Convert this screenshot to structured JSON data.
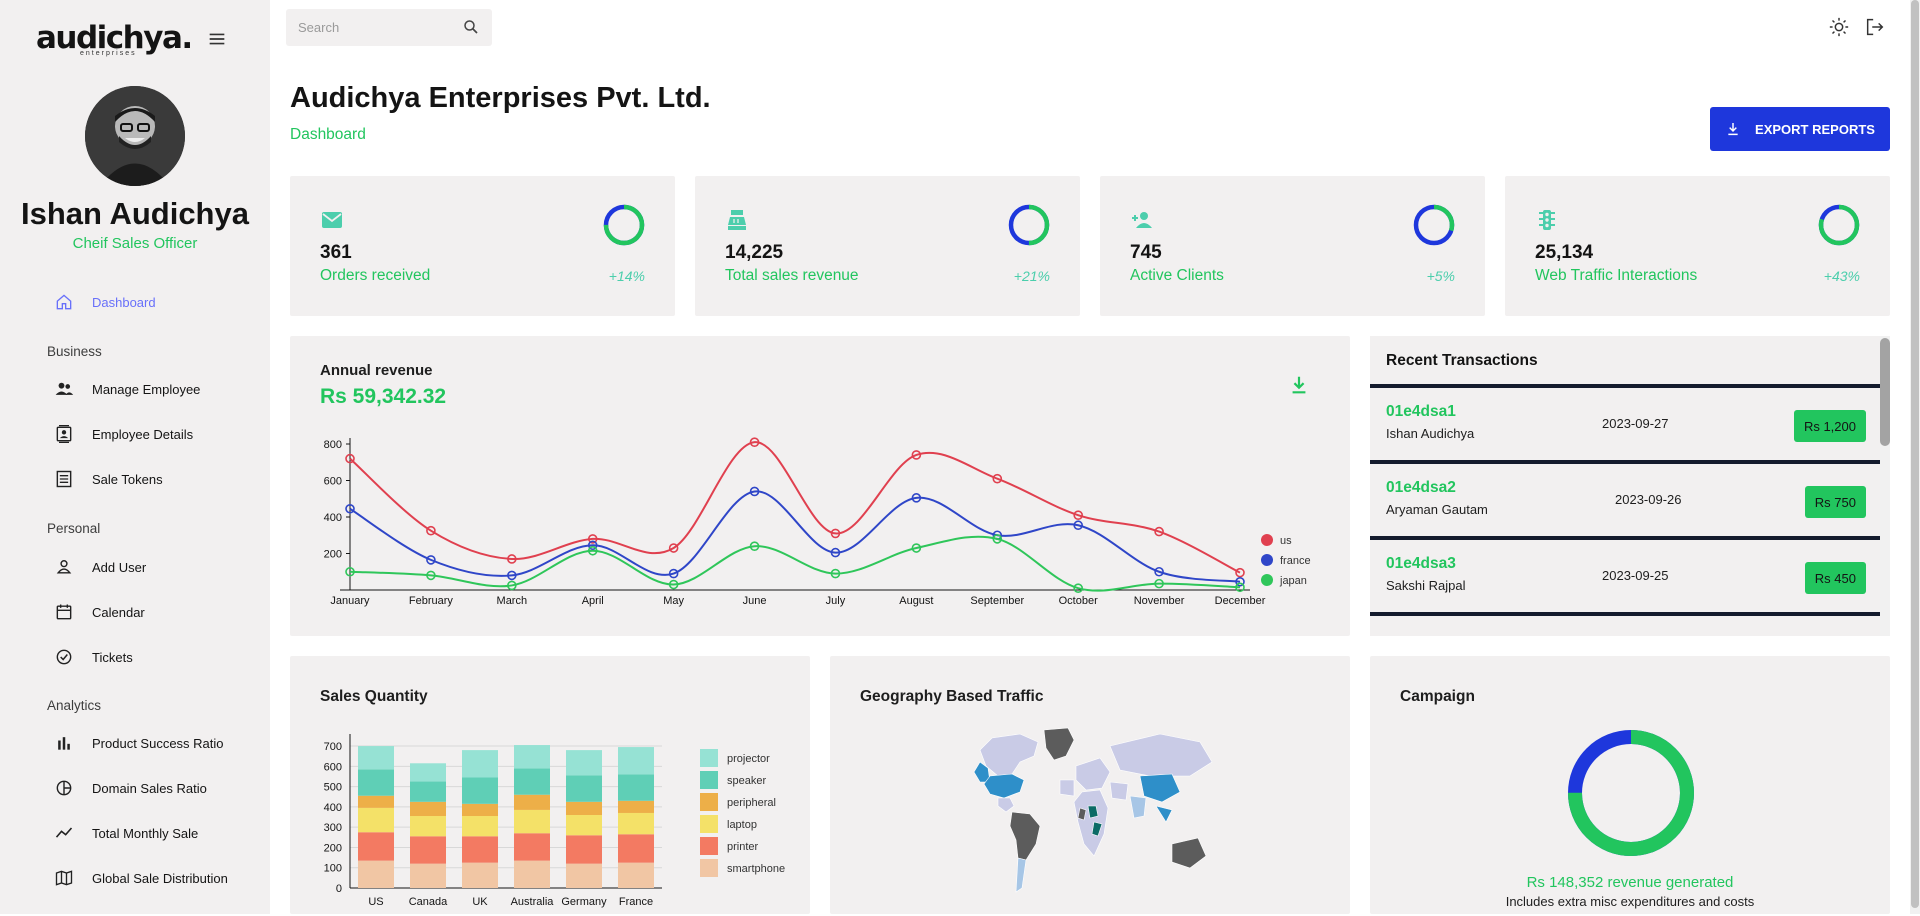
{
  "brand": {
    "logo_text": "audichya.",
    "logo_sub": "enterprises"
  },
  "user": {
    "name": "Ishan Audichya",
    "role": "Cheif Sales Officer"
  },
  "nav": {
    "dashboard": "Dashboard",
    "sections": [
      "Business",
      "Personal",
      "Analytics"
    ],
    "business": [
      "Manage Employee",
      "Employee Details",
      "Sale Tokens"
    ],
    "personal": [
      "Add User",
      "Calendar",
      "Tickets"
    ],
    "analytics": [
      "Product Success Ratio",
      "Domain Sales Ratio",
      "Total Monthly Sale",
      "Global Sale Distribution"
    ]
  },
  "search": {
    "placeholder": "Search"
  },
  "header": {
    "title": "Audichya Enterprises Pvt. Ltd.",
    "subtitle": "Dashboard",
    "export_label": "EXPORT REPORTS"
  },
  "stats": [
    {
      "value": "361",
      "label": "Orders received",
      "pct": "+14%",
      "progress": 0.75,
      "icon": "email-icon"
    },
    {
      "value": "14,225",
      "label": "Total sales revenue",
      "pct": "+21%",
      "progress": 0.5,
      "icon": "point-of-sale-icon"
    },
    {
      "value": "745",
      "label": "Active Clients",
      "pct": "+5%",
      "progress": 0.3,
      "icon": "person-add-icon"
    },
    {
      "value": "25,134",
      "label": "Web Traffic Interactions",
      "pct": "+43%",
      "progress": 0.8,
      "icon": "traffic-icon"
    }
  ],
  "revenue": {
    "title": "Annual revenue",
    "amount": "Rs 59,342.32"
  },
  "transactions": {
    "title": "Recent Transactions",
    "items": [
      {
        "id": "01e4dsa1",
        "user": "Ishan Audichya",
        "date": "2023-09-27",
        "cost": "Rs 1,200"
      },
      {
        "id": "01e4dsa2",
        "user": "Aryaman Gautam",
        "date": "2023-09-26",
        "cost": "Rs 750"
      },
      {
        "id": "01e4dsa3",
        "user": "Sakshi Rajpal",
        "date": "2023-09-25",
        "cost": "Rs 450"
      }
    ]
  },
  "sales_title": "Sales Quantity",
  "geo_title": "Geography Based Traffic",
  "campaign": {
    "title": "Campaign",
    "revenue": "Rs 148,352 revenue generated",
    "note": "Includes extra misc expenditures and costs",
    "progress": 0.75
  },
  "colors": {
    "accent": "#22c55e",
    "blue": "#1e37dc",
    "nav_active": "#6870fa",
    "card_bg": "#f2f0f0"
  },
  "chart_data": [
    {
      "type": "line",
      "title": "",
      "categories": [
        "January",
        "February",
        "March",
        "April",
        "May",
        "June",
        "July",
        "August",
        "September",
        "October",
        "November",
        "December"
      ],
      "series": [
        {
          "name": "us",
          "color": "#e0404f",
          "values": [
            720,
            325,
            170,
            280,
            230,
            810,
            310,
            740,
            610,
            410,
            320,
            95
          ]
        },
        {
          "name": "france",
          "color": "#2f46c8",
          "values": [
            445,
            165,
            80,
            245,
            90,
            540,
            205,
            505,
            300,
            355,
            100,
            45
          ]
        },
        {
          "name": "japan",
          "color": "#2fc65a",
          "values": [
            100,
            80,
            25,
            215,
            30,
            240,
            90,
            230,
            280,
            10,
            35,
            15
          ]
        }
      ],
      "yticks": [
        200,
        400,
        600,
        800
      ],
      "ylim": [
        0,
        800
      ],
      "legend": "right"
    },
    {
      "type": "bar",
      "stacked": true,
      "categories": [
        "US",
        "Canada",
        "UK",
        "Australia",
        "Germany",
        "France"
      ],
      "series": [
        {
          "name": "smartphone",
          "color": "#f1c6a4",
          "values": [
            135,
            120,
            125,
            135,
            120,
            125
          ]
        },
        {
          "name": "printer",
          "color": "#f37a62",
          "values": [
            140,
            135,
            130,
            135,
            140,
            140
          ]
        },
        {
          "name": "laptop",
          "color": "#f4e168",
          "values": [
            120,
            100,
            100,
            115,
            100,
            105
          ]
        },
        {
          "name": "peripheral",
          "color": "#edaf48",
          "values": [
            60,
            70,
            60,
            75,
            65,
            60
          ]
        },
        {
          "name": "speaker",
          "color": "#5fcfb6",
          "values": [
            130,
            100,
            130,
            130,
            130,
            130
          ]
        },
        {
          "name": "projector",
          "color": "#96e2d4",
          "values": [
            115,
            90,
            135,
            115,
            125,
            135
          ]
        }
      ],
      "yticks": [
        0,
        100,
        200,
        300,
        400,
        500,
        600,
        700
      ],
      "ylim": [
        0,
        720
      ],
      "legend": "right"
    }
  ]
}
